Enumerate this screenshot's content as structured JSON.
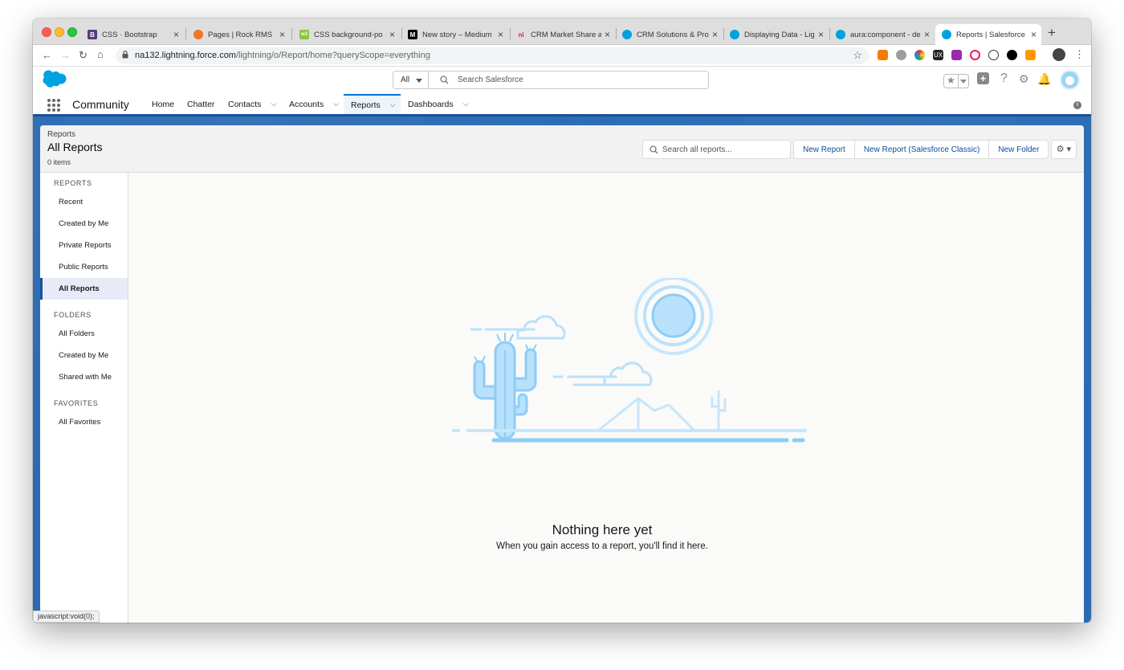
{
  "browser": {
    "tabs": [
      {
        "title": "CSS · Bootstrap",
        "fav_color": "#563d7c",
        "fav_glyph": "B"
      },
      {
        "title": "Pages | Rock RMS",
        "fav_color": "#ee7624",
        "fav_glyph": "◆"
      },
      {
        "title": "CSS background-po",
        "fav_color": "#8cc63f",
        "fav_glyph": "w3"
      },
      {
        "title": "New story – Medium",
        "fav_color": "#000000",
        "fav_glyph": "M"
      },
      {
        "title": "CRM Market Share a",
        "fav_color": "#ffffff",
        "fav_glyph": "n"
      },
      {
        "title": "CRM Solutions & Pro",
        "fav_color": "#00a1e0",
        "fav_glyph": "☁"
      },
      {
        "title": "Displaying Data - Lig",
        "fav_color": "#00a1e0",
        "fav_glyph": "☁"
      },
      {
        "title": "aura:component - de",
        "fav_color": "#00a1e0",
        "fav_glyph": "☁"
      },
      {
        "title": "Reports | Salesforce",
        "fav_color": "#00a1e0",
        "fav_glyph": "☁"
      }
    ],
    "new_tab": "+",
    "url_host": "na132.lightning.force.com",
    "url_path": "/lightning/o/Report/home?queryScope=everything",
    "status_text": "javascript:void(0);"
  },
  "header": {
    "search_scope": "All",
    "search_placeholder": "Search Salesforce"
  },
  "appnav": {
    "app_name": "Community",
    "items": [
      {
        "label": "Home"
      },
      {
        "label": "Chatter"
      },
      {
        "label": "Contacts"
      },
      {
        "label": "Accounts"
      },
      {
        "label": "Reports"
      },
      {
        "label": "Dashboards"
      }
    ],
    "chevron": "⌵"
  },
  "page": {
    "breadcrumb": "Reports",
    "title": "All Reports",
    "count": "0 items",
    "search_placeholder": "Search all reports...",
    "buttons": {
      "new_report": "New Report",
      "new_report_classic": "New Report (Salesforce Classic)",
      "new_folder": "New Folder"
    }
  },
  "sidebar": {
    "reports_heading": "REPORTS",
    "reports_items": [
      "Recent",
      "Created by Me",
      "Private Reports",
      "Public Reports",
      "All Reports"
    ],
    "selected_item": "All Reports",
    "folders_heading": "FOLDERS",
    "folders_items": [
      "All Folders",
      "Created by Me",
      "Shared with Me"
    ],
    "favorites_heading": "FAVORITES",
    "favorites_items": [
      "All Favorites"
    ]
  },
  "empty_state": {
    "title": "Nothing here yet",
    "subtitle": "When you gain access to a report, you'll find it here."
  },
  "colors": {
    "brand_blue": "#1b5297",
    "link_blue": "#0b4d99",
    "illustration_light": "#b9e1fb",
    "illustration_mid": "#8dcdf6"
  }
}
